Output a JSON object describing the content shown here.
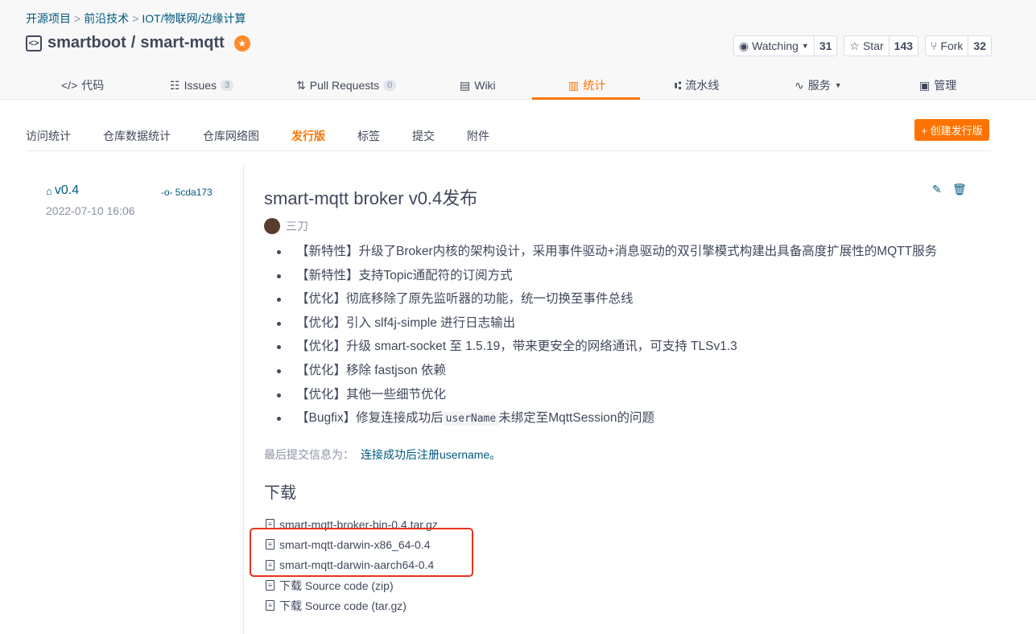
{
  "breadcrumb": [
    "开源项目",
    "前沿技术",
    "IOT/物联网/边缘计算"
  ],
  "breadcrumb_sep": ">",
  "repo": {
    "owner": "smartboot",
    "separator": "/",
    "name": "smart-mqtt"
  },
  "actions": {
    "watch": {
      "label": "Watching",
      "count": "31"
    },
    "star": {
      "label": "Star",
      "count": "143"
    },
    "fork": {
      "label": "Fork",
      "count": "32"
    }
  },
  "tabs": [
    {
      "label": "代码",
      "icon": "code-icon"
    },
    {
      "label": "Issues",
      "icon": "issues-icon",
      "count": "3"
    },
    {
      "label": "Pull Requests",
      "icon": "pull-request-icon",
      "count": "0"
    },
    {
      "label": "Wiki",
      "icon": "wiki-icon"
    },
    {
      "label": "统计",
      "icon": "chart-icon",
      "active": true
    },
    {
      "label": "流水线",
      "icon": "pipeline-icon"
    },
    {
      "label": "服务",
      "icon": "pulse-icon"
    },
    {
      "label": "管理",
      "icon": "manage-icon"
    }
  ],
  "subnav": [
    "访问统计",
    "仓库数据统计",
    "仓库网络图",
    "发行版",
    "标签",
    "提交",
    "附件"
  ],
  "new_release_button": "+ 创建发行版",
  "release": {
    "tag": "v0.4",
    "commit": "5cda173",
    "date": "2022-07-10 16:06",
    "title": "smart-mqtt broker v0.4发布",
    "author": "三刀",
    "notes": [
      "【新特性】升级了Broker内核的架构设计，采用事件驱动+消息驱动的双引擎模式构建出具备高度扩展性的MQTT服务",
      "【新特性】支持Topic通配符的订阅方式",
      "【优化】彻底移除了原先监听器的功能，统一切换至事件总线",
      "【优化】引入 slf4j-simple 进行日志输出",
      "【优化】升级 smart-socket 至 1.5.19，带来更安全的网络通讯，可支持 TLSv1.3",
      "【优化】移除 fastjson 依赖",
      "【优化】其他一些细节优化"
    ],
    "bugfix_note": {
      "prefix": "【Bugfix】修复连接成功后",
      "code": "userName",
      "suffix": "未绑定至MqttSession的问题"
    },
    "last_commit_label": "最后提交信息为：",
    "last_commit_msg": "连接成功后注册username。",
    "download_heading": "下载",
    "files": [
      "smart-mqtt-broker-bin-0.4.tar.gz",
      "smart-mqtt-darwin-x86_64-0.4",
      "smart-mqtt-darwin-aarch64-0.4",
      "下载 Source code (zip)",
      "下载 Source code (tar.gz)"
    ]
  },
  "colors": {
    "accent": "#fe7300",
    "link": "#005980",
    "highlight": "#e8331f"
  }
}
